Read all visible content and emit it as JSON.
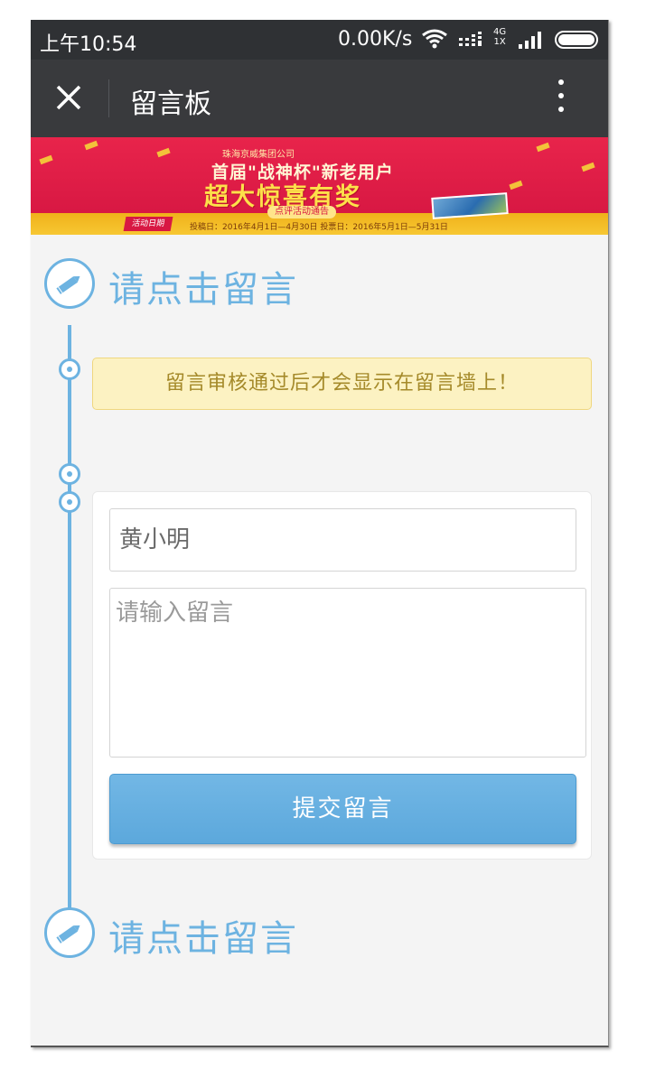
{
  "status_bar": {
    "time": "上午10:54",
    "speed": "0.00K/s",
    "network_line1": "4G",
    "network_line2": "1X",
    "icons": [
      "wifi-icon",
      "signal-icon",
      "signal-icon",
      "battery-icon"
    ]
  },
  "nav": {
    "close_icon": "close-icon",
    "title": "留言板",
    "more_icon": "more-vertical-icon"
  },
  "banner": {
    "company": "珠海京威集团公司",
    "headline": "首届\"战神杯\"新老用户",
    "big_text": "超大惊喜有奖",
    "notice": "点评活动通告",
    "badge": "活动日期",
    "dates": "投稿日：2016年4月1日—4月30日   投票日：2016年5月1日—5月31日"
  },
  "timeline": {
    "top_prompt": "请点击留言",
    "bottom_prompt": "请点击留言",
    "icon": "pencil-icon"
  },
  "notice": {
    "text": "留言审核通过后才会显示在留言墙上！"
  },
  "form": {
    "name_value": "黄小明",
    "message_placeholder": "请输入留言",
    "submit_label": "提交留言"
  },
  "colors": {
    "accent": "#6db3e1",
    "button": "#5ca8dc",
    "notice_bg": "#fcf2c2",
    "notice_text": "#a58a2a",
    "nav_bg": "#393a3d",
    "status_bg": "#2f3134",
    "banner_red": "#d81843",
    "banner_gold": "#f7c733"
  }
}
